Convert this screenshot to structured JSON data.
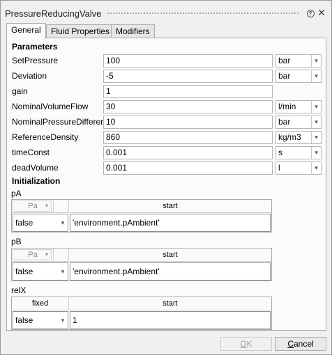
{
  "window": {
    "title": "PressureReducingValve",
    "help_glyph": "?",
    "close_glyph": "✕"
  },
  "tabs": [
    {
      "label": "General",
      "active": true
    },
    {
      "label": "Fluid Properties",
      "active": false
    },
    {
      "label": "Modifiers",
      "active": false
    }
  ],
  "parameters": {
    "heading": "Parameters",
    "rows": [
      {
        "label": "SetPressure",
        "value": "100",
        "unit": "bar"
      },
      {
        "label": "Deviation",
        "value": "-5",
        "unit": "bar"
      },
      {
        "label": "gain",
        "value": "1",
        "unit": null
      },
      {
        "label": "NominalVolumeFlow",
        "value": "30",
        "unit": "l/min"
      },
      {
        "label": "NominalPressureDifference",
        "value": "10",
        "unit": "bar"
      },
      {
        "label": "ReferenceDensity",
        "value": "860",
        "unit": "kg/m3"
      },
      {
        "label": "timeConst",
        "value": "0.001",
        "unit": "s"
      },
      {
        "label": "deadVolume",
        "value": "0.001",
        "unit": "l"
      }
    ]
  },
  "initialization": {
    "heading": "Initialization",
    "groups": [
      {
        "label": "pA",
        "col1_header": "Pa",
        "col1_header_is_combo": true,
        "col2_header": "start",
        "fixed": "false",
        "start": "'environment.pAmbient'"
      },
      {
        "label": "pB",
        "col1_header": "Pa",
        "col1_header_is_combo": true,
        "col2_header": "start",
        "fixed": "false",
        "start": "'environment.pAmbient'"
      },
      {
        "label": "relX",
        "col1_header": "fixed",
        "col1_header_is_combo": false,
        "col2_header": "start",
        "fixed": "false",
        "start": "1"
      }
    ]
  },
  "buttons": {
    "ok": {
      "label": "OK",
      "mnemonic": "O",
      "rest": "K",
      "enabled": false
    },
    "cancel": {
      "label": "Cancel",
      "mnemonic": "C",
      "rest": "ancel",
      "enabled": true
    }
  },
  "icons": {
    "dropdown": "▾",
    "colors": {
      "border": "#a9a9a9",
      "panel": "#fbfbfb",
      "window": "#f0f0f0"
    }
  }
}
